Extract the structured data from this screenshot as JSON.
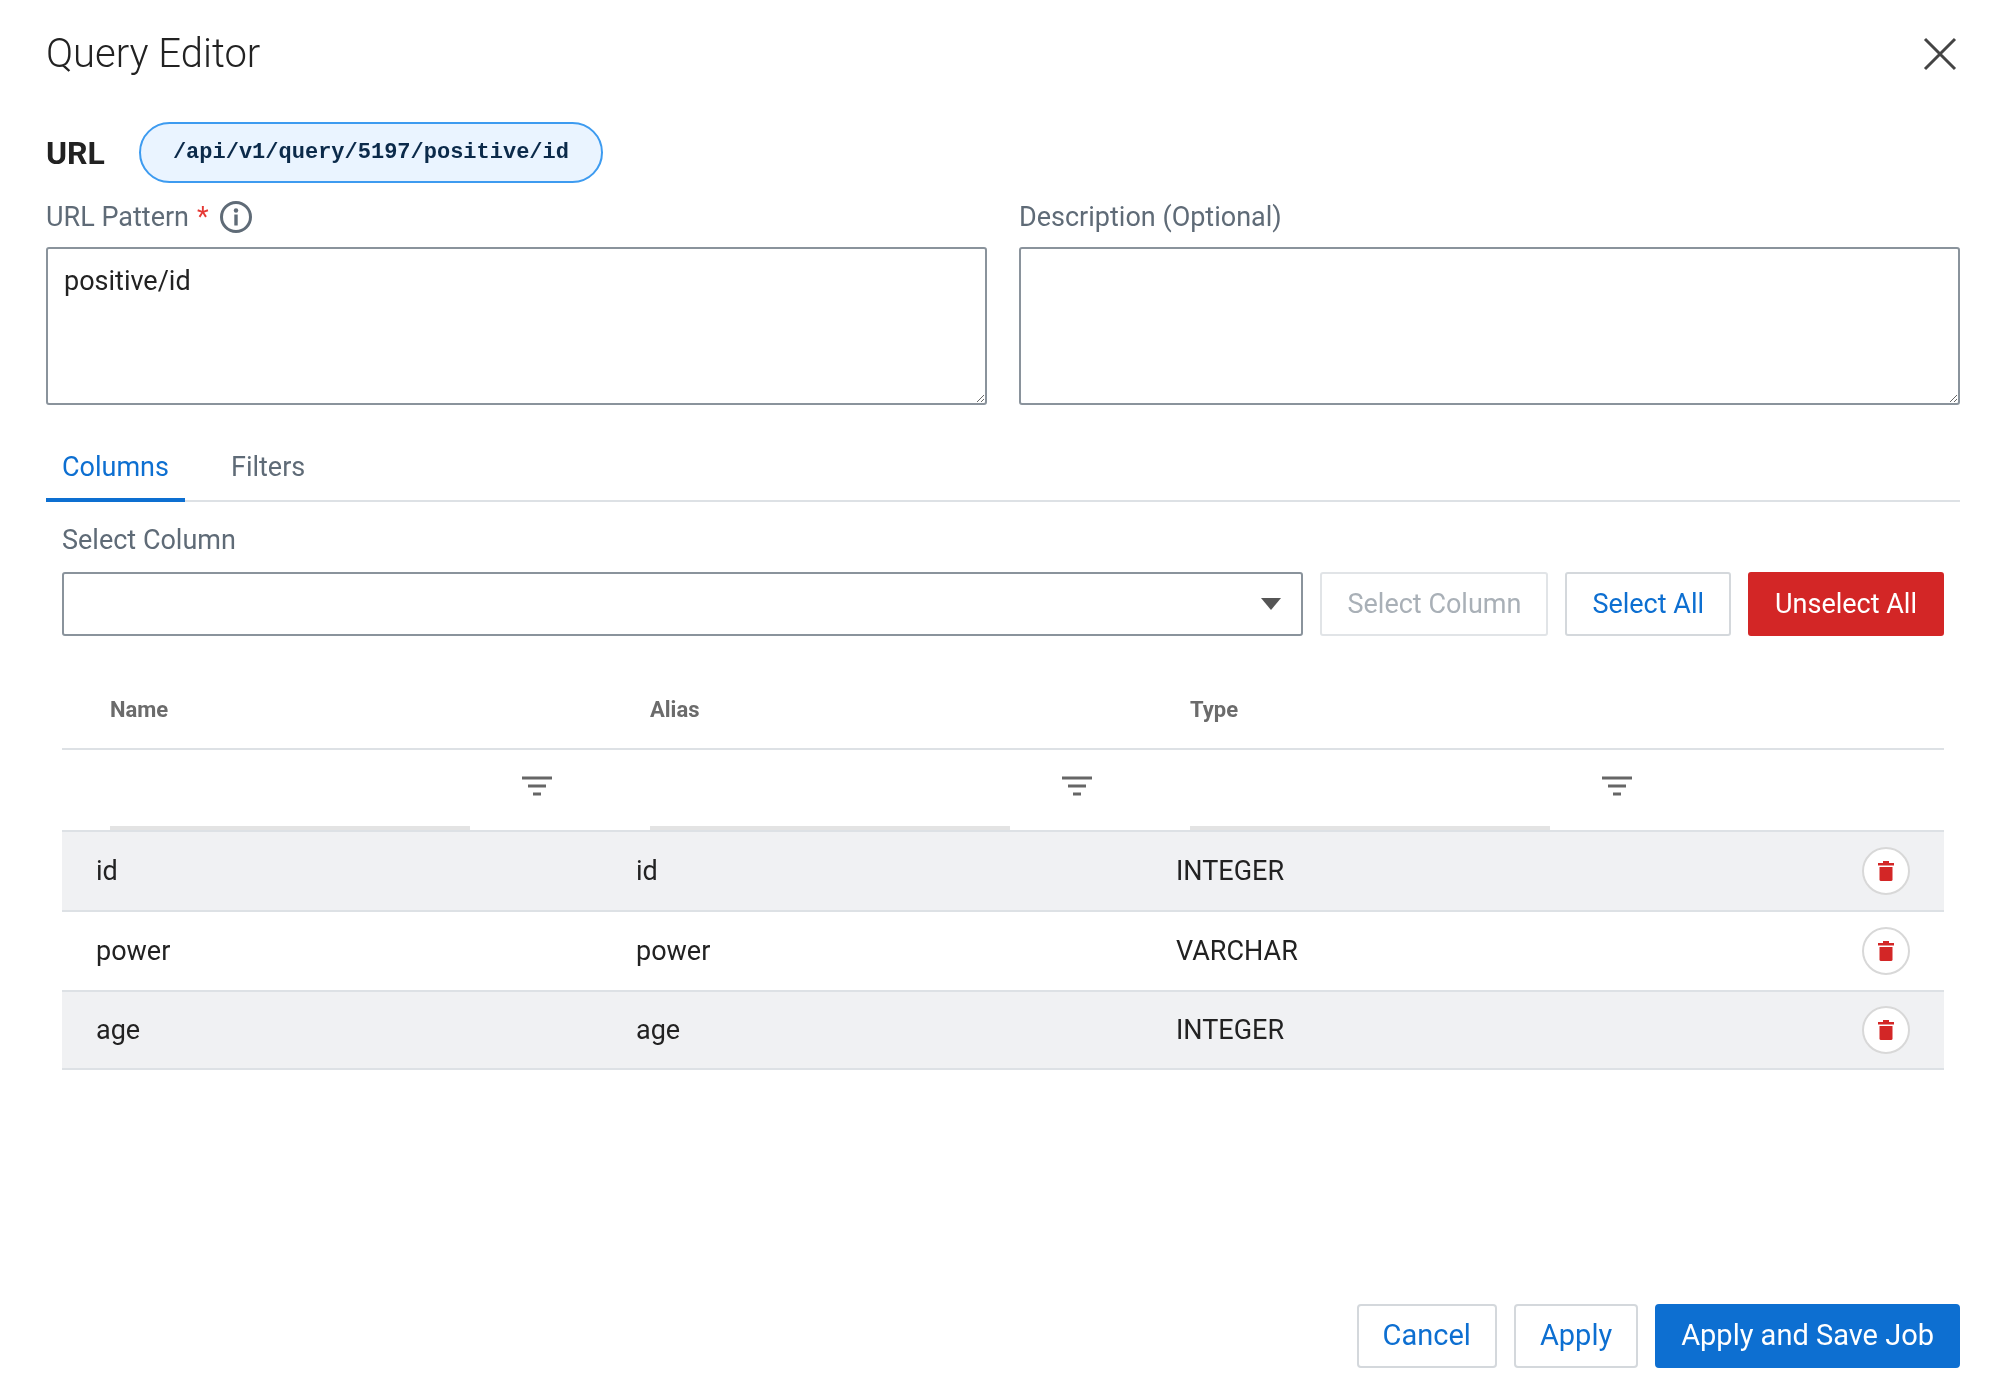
{
  "dialog": {
    "title": "Query Editor"
  },
  "url": {
    "label": "URL",
    "value": "/api/v1/query/5197/positive/id"
  },
  "url_pattern": {
    "label": "URL Pattern",
    "required_mark": "*",
    "value": "positive/id"
  },
  "description": {
    "label": "Description (Optional)"
  },
  "tabs": [
    {
      "label": "Columns",
      "selected": true
    },
    {
      "label": "Filters",
      "selected": false
    }
  ],
  "select_column": {
    "label": "Select Column"
  },
  "column_buttons": [
    {
      "label": "Select Column",
      "kind": "outline",
      "disabled": true
    },
    {
      "label": "Select All",
      "kind": "outline",
      "disabled": false
    },
    {
      "label": "Unselect All",
      "kind": "danger",
      "disabled": false
    }
  ],
  "table": {
    "columns": [
      "Name",
      "Alias",
      "Type"
    ],
    "rows": [
      {
        "name": "id",
        "alias": "id",
        "type": "INTEGER"
      },
      {
        "name": "power",
        "alias": "power",
        "type": "VARCHAR"
      },
      {
        "name": "age",
        "alias": "age",
        "type": "INTEGER"
      }
    ]
  },
  "footer_buttons": [
    {
      "label": "Cancel",
      "kind": "outline"
    },
    {
      "label": "Apply",
      "kind": "outline"
    },
    {
      "label": "Apply and Save Job",
      "kind": "primary"
    }
  ]
}
